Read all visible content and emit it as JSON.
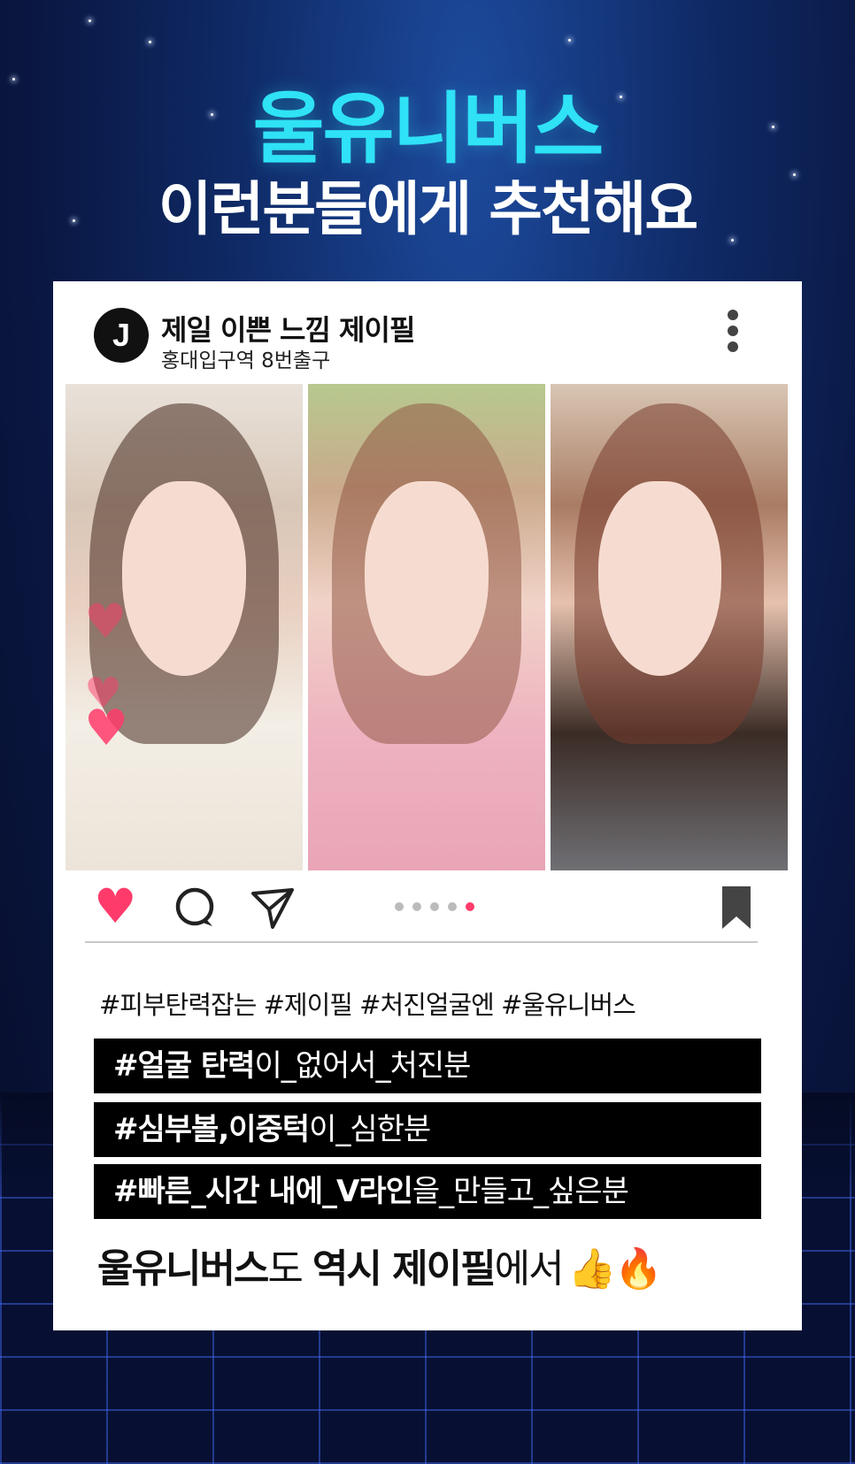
{
  "header": {
    "title": "울유니버스",
    "subtitle": "이런분들에게 추천해요"
  },
  "post": {
    "avatar_letter": "J",
    "account_name": "제일 이쁜 느낌 제이필",
    "location": "홍대입구역 8번출구",
    "photo_count": 5,
    "active_photo_index": 5,
    "liked": true,
    "hashtags": "#피부탄력잡는 #제이필 #처진얼굴엔 #울유니버스",
    "highlight_lines": [
      {
        "bold": "#얼굴 탄력",
        "rest": "이_없어서_처진분"
      },
      {
        "bold": "#심부볼,이중턱",
        "rest": "이_심한분"
      },
      {
        "bold": "#빠른_시간 내에_V라인",
        "rest": "을_만들고_싶은분"
      }
    ],
    "closing": {
      "part1_bold": "울유니버스",
      "part2": "도 ",
      "part3_bold": "역시 제이필",
      "part4": "에서",
      "emojis": "👍🔥"
    }
  },
  "colors": {
    "title_accent": "#2fe2f5",
    "like": "#ff3b6b",
    "background_top": "#1d4b9e",
    "background_bottom": "#050b24"
  },
  "icons": [
    "more-vertical-icon",
    "heart-icon",
    "comment-icon",
    "send-icon",
    "bookmark-icon"
  ]
}
